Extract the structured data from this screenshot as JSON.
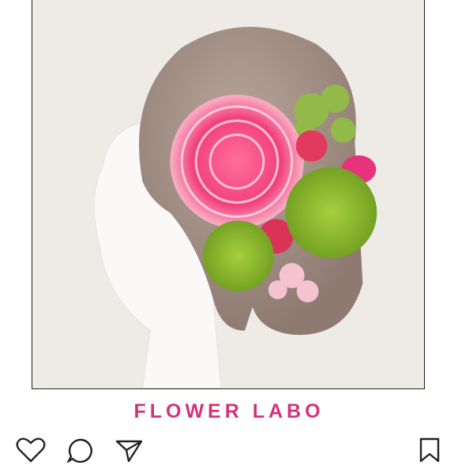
{
  "post": {
    "brand_text": "FLOWER LABO",
    "brand_color": "#d6307a"
  },
  "actions": {
    "icons": [
      "heart-icon",
      "comment-icon",
      "share-icon",
      "bookmark-icon"
    ]
  }
}
